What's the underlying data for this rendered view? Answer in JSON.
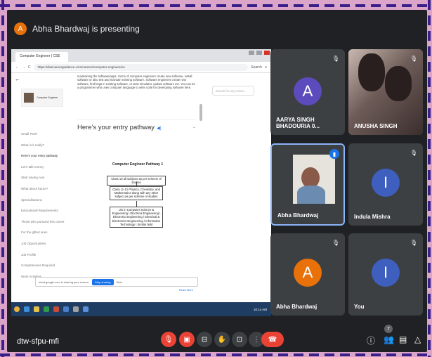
{
  "presenting": {
    "avatar_initial": "A",
    "text": "Abha Bhardwaj is presenting"
  },
  "browser": {
    "tab_title": "Computer Engineer | CSE",
    "url": "https://disecareerguidance.com/careers/computer-engineer/en",
    "search_placeholder": "Search"
  },
  "webpage": {
    "site_label": "Computer Engineer",
    "intro_paragraph": "maintaining the software/apps. Some of computer engineers create new software, install software or also test and maintain existing software. Software engineers create new software, find bugs in existing software, or write simulator, update software etc. You can be a programmer who uses computer language to write code for developing software here.",
    "search_careers_placeholder": "Search for any Career",
    "pathway_heading": "Here's your entry pathway",
    "sidebar_items": [
      "Small Peek",
      "What is it really?",
      "Here's your entry pathway",
      "Let's talk money",
      "Start saving now",
      "What about future?",
      "Specialisations",
      "Educational Requirements",
      "Those who pursued this career",
      "For the gifted ones",
      "Job Opportunities",
      "Job Profile",
      "Competencies Required",
      "Work Activities"
    ],
    "flowchart": {
      "title": "Computer Engineer Pathway 1",
      "steps": [
        "Class 10 all subjects as per scheme of studies",
        "Class 11-12 Physics, Chemistry, and Mathematics along with any other subject as per scheme of studies",
        "UG in Computer Science & Engineering \\ Electrical Engineering \\ Electronic Engineering \\ Electrical & Electronics Engineering \\ Information Technology \\ Similar field"
      ]
    },
    "share_banner_text": "meet.google.com is sharing your screen.",
    "stop_sharing_label": "Stop sharing",
    "hide_label": "Hide",
    "read_more_label": "Read More",
    "taskbar_time": "10:14 AM"
  },
  "participants": [
    {
      "name": "AARYA SINGH BHADOURIA 0...",
      "initial": "A",
      "avatar_color": "#5c4bbd",
      "muted": true,
      "camera": false
    },
    {
      "name": "ANUSHA SINGH",
      "initial": "",
      "avatar_color": "",
      "muted": true,
      "camera": true
    },
    {
      "name": "Abha Bhardwaj",
      "initial": "",
      "avatar_color": "",
      "muted": false,
      "speaking": true,
      "camera": true
    },
    {
      "name": "Indula Mishra",
      "initial": "I",
      "avatar_color": "#3f5fbf",
      "muted": true,
      "camera": false
    },
    {
      "name": "Abha Bhardwaj",
      "initial": "A",
      "avatar_color": "#e8710a",
      "muted": true,
      "camera": false
    },
    {
      "name": "You",
      "initial": "I",
      "avatar_color": "#3f5fbf",
      "muted": true,
      "camera": false
    }
  ],
  "controls": {
    "meeting_code": "dtw-sfpu-mfi",
    "people_count": "7"
  },
  "colors": {
    "meet_bg": "#202124",
    "tile_bg": "#3c4043",
    "danger": "#ea4335",
    "accent": "#1a73e8",
    "speaking_border": "#8ab4f8"
  }
}
